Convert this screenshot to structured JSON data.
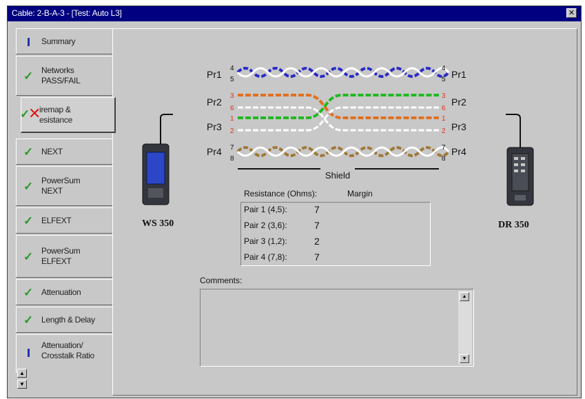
{
  "window": {
    "title": "Cable: 2-B-A-3 - [Test: Auto L3]",
    "close_glyph": "✕"
  },
  "tabs": [
    {
      "label": "Summary",
      "status": "info"
    },
    {
      "label": "Networks PASS/FAIL",
      "status": "pass"
    },
    {
      "label": "iremap & esistance",
      "status": "fail"
    },
    {
      "label": "NEXT",
      "status": "pass"
    },
    {
      "label": "PowerSum NEXT",
      "status": "pass"
    },
    {
      "label": "ELFEXT",
      "status": "pass"
    },
    {
      "label": "PowerSum ELFEXT",
      "status": "pass"
    },
    {
      "label": "Attenuation",
      "status": "pass"
    },
    {
      "label": "Length & Delay",
      "status": "pass"
    },
    {
      "label": "Attenuation/ Crosstalk Ratio",
      "status": "info"
    }
  ],
  "wiremap": {
    "pairs": [
      {
        "label": "Pr1",
        "pins_left": [
          "4",
          "5"
        ],
        "pins_right": [
          "4",
          "5"
        ],
        "color": "#2a2ac8"
      },
      {
        "label": "Pr2",
        "pins_left": [
          "3",
          "6"
        ],
        "pins_right": [
          "3",
          "6"
        ],
        "color": "#e07020"
      },
      {
        "label": "Pr3",
        "pins_left": [
          "1",
          "2"
        ],
        "pins_right": [
          "1",
          "2"
        ],
        "color": "#22b822"
      },
      {
        "label": "Pr4",
        "pins_left": [
          "7",
          "8"
        ],
        "pins_right": [
          "7",
          "8"
        ],
        "color": "#a07838"
      }
    ],
    "shield_label": "Shield"
  },
  "devices": {
    "left": "WS 350",
    "right": "DR 350"
  },
  "resistance": {
    "header_label": "Resistance (Ohms):",
    "header_margin": "Margin",
    "rows": [
      {
        "pair": "Pair 1 (4,5):",
        "value": "7"
      },
      {
        "pair": "Pair 2 (3,6):",
        "value": "7"
      },
      {
        "pair": "Pair 3 (1,2):",
        "value": "2"
      },
      {
        "pair": "Pair 4 (7,8):",
        "value": "7"
      }
    ]
  },
  "comments": {
    "label": "Comments:",
    "value": ""
  }
}
